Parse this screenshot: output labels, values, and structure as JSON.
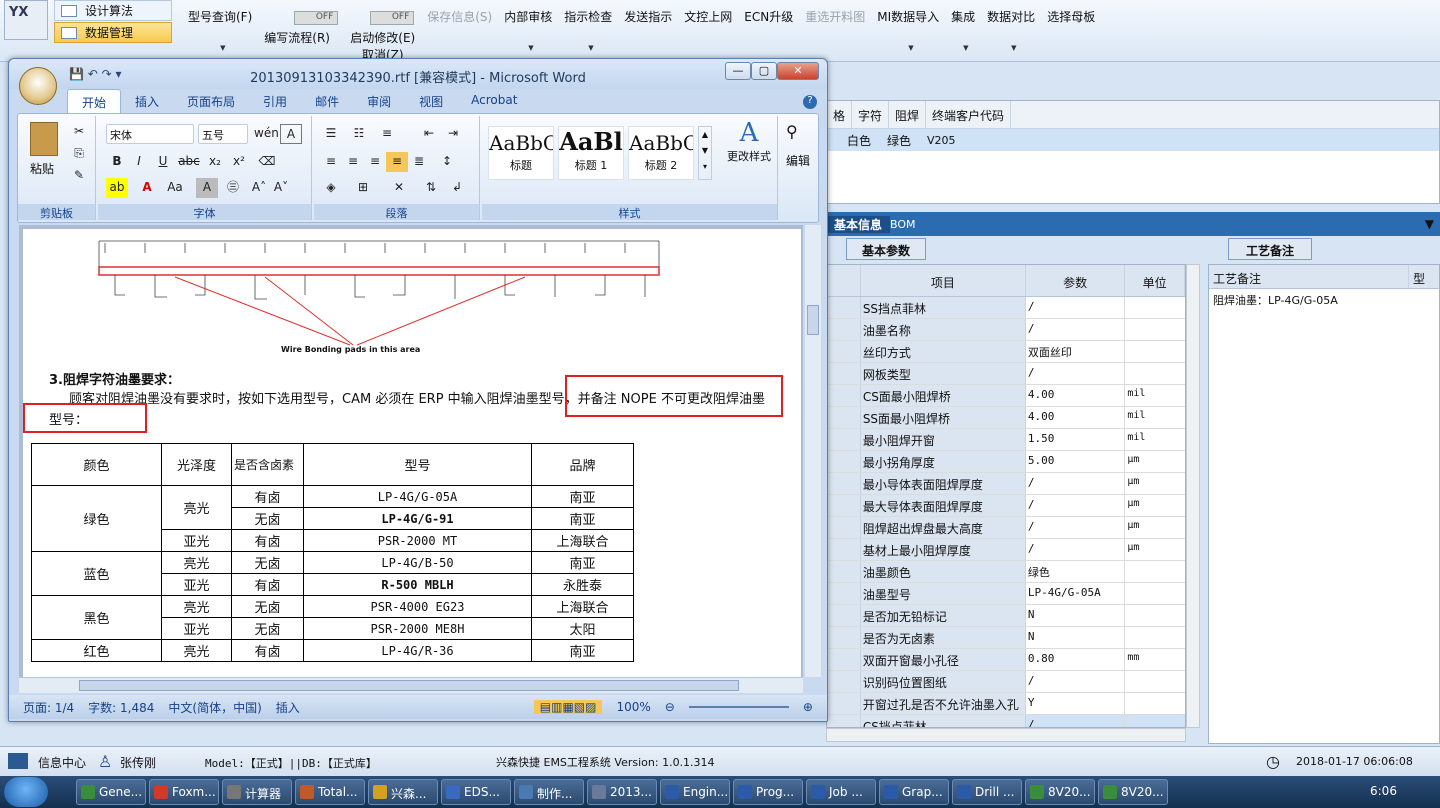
{
  "erp": {
    "logo": "YX",
    "nav": [
      "设计算法",
      "数据管理"
    ],
    "commands": [
      {
        "label": "型号查询(F)",
        "disabled": false
      },
      {
        "label": "编写流程(R)",
        "disabled": false,
        "toggle": "OFF"
      },
      {
        "label": "启动修改(E)",
        "disabled": false,
        "toggle": "OFF",
        "sub": "取消(Z)"
      },
      {
        "label": "保存信息(S)",
        "disabled": true
      },
      {
        "label": "内部审核",
        "disabled": false
      },
      {
        "label": "指示检查",
        "disabled": false
      },
      {
        "label": "发送指示",
        "disabled": false
      },
      {
        "label": "文控上网",
        "disabled": false
      },
      {
        "label": "ECN升级",
        "disabled": false
      },
      {
        "label": "重选开料图",
        "disabled": true
      },
      {
        "label": "MI数据导入",
        "disabled": false
      },
      {
        "label": "集成",
        "disabled": false
      },
      {
        "label": "数据对比",
        "disabled": false
      },
      {
        "label": "选择母板",
        "disabled": false
      }
    ],
    "upper_columns": [
      "格",
      "字符",
      "阻焊",
      "终端客户代码"
    ],
    "upper_row": [
      "白色",
      "绿色",
      "V205"
    ],
    "tabs": [
      "基本信息",
      "BOM"
    ],
    "param_tab": "基本参数",
    "param_headers": [
      "项目",
      "参数",
      "单位"
    ],
    "params": [
      [
        "SS挡点菲林",
        "/",
        ""
      ],
      [
        "油墨名称",
        "/",
        ""
      ],
      [
        "丝印方式",
        "双面丝印",
        ""
      ],
      [
        "网板类型",
        "/",
        ""
      ],
      [
        "CS面最小阻焊桥",
        "4.00",
        "mil"
      ],
      [
        "SS面最小阻焊桥",
        "4.00",
        "mil"
      ],
      [
        "最小阻焊开窗",
        "1.50",
        "mil"
      ],
      [
        "最小拐角厚度",
        "5.00",
        "μm"
      ],
      [
        "最小导体表面阻焊厚度",
        "/",
        "μm"
      ],
      [
        "最大导体表面阻焊厚度",
        "/",
        "μm"
      ],
      [
        "阻焊超出焊盘最大高度",
        "/",
        "μm"
      ],
      [
        "基材上最小阻焊厚度",
        "/",
        "μm"
      ],
      [
        "油墨颜色",
        "绿色",
        ""
      ],
      [
        "油墨型号",
        "LP-4G/G-05A",
        ""
      ],
      [
        "是否加无铅标记",
        "N",
        ""
      ],
      [
        "是否为无卤素",
        "N",
        ""
      ],
      [
        "双面开窗最小孔径",
        "0.80",
        "mm"
      ],
      [
        "识别码位置图纸",
        "/",
        ""
      ],
      [
        "开窗过孔是否不允许油墨入孔",
        "Y",
        ""
      ],
      [
        "CS挡点菲林",
        "/",
        ""
      ]
    ],
    "craft_tab": "工艺备注",
    "craft_headers": [
      "工艺备注",
      "型"
    ],
    "craft_text": "阻焊油墨：LP-4G/G-05A",
    "status": {
      "info": "信息中心",
      "user": "张传刚",
      "model": "Model:【正式】||DB:【正式库】",
      "system": "兴森快捷 EMS工程系统 Version: 1.0.1.314",
      "datetime": "2018-01-17 06:06:08"
    }
  },
  "word": {
    "title": "20130913103342390.rtf [兼容模式] - Microsoft Word",
    "tabs": [
      "开始",
      "插入",
      "页面布局",
      "引用",
      "邮件",
      "审阅",
      "视图",
      "Acrobat"
    ],
    "font": "宋体",
    "size": "五号",
    "groups": [
      "剪贴板",
      "字体",
      "段落",
      "样式",
      "编辑"
    ],
    "paste": "粘贴",
    "styles": [
      {
        "sample": "AaBbC",
        "name": "标题"
      },
      {
        "sample": "AaBl",
        "name": "标题 1"
      },
      {
        "sample": "AaBbC",
        "name": "标题 2"
      }
    ],
    "change_style": "更改样式",
    "edit": "编辑",
    "caption": "Wire Bonding pads in this area",
    "heading": "3.阻焊字符油墨要求：",
    "paragraph": "顾客对阻焊油墨没有要求时，按如下选用型号，CAM 必须在 ERP 中输入阻焊油墨型号，并备注 NOPE 不可更改阻焊油墨型号：",
    "table_headers": [
      "颜色",
      "光泽度",
      "是否含卤素",
      "型号",
      "品牌"
    ],
    "table": [
      {
        "color": "绿色",
        "gloss": "亮光",
        "halogen": "有卤",
        "model": "LP-4G/G-05A",
        "brand": "南亚"
      },
      {
        "color": "",
        "gloss": "",
        "halogen": "无卤",
        "model": "LP-4G/G-91",
        "brand": "南亚"
      },
      {
        "color": "",
        "gloss": "亚光",
        "halogen": "有卤",
        "model": "PSR-2000 MT",
        "brand": "上海联合"
      },
      {
        "color": "蓝色",
        "gloss": "亮光",
        "halogen": "无卤",
        "model": "LP-4G/B-50",
        "brand": "南亚"
      },
      {
        "color": "",
        "gloss": "亚光",
        "halogen": "有卤",
        "model": "R-500 MBLH",
        "brand": "永胜泰"
      },
      {
        "color": "黑色",
        "gloss": "亮光",
        "halogen": "无卤",
        "model": "PSR-4000 EG23",
        "brand": "上海联合"
      },
      {
        "color": "",
        "gloss": "亚光",
        "halogen": "无卤",
        "model": "PSR-2000 ME8H",
        "brand": "太阳"
      },
      {
        "color": "红色",
        "gloss": "亮光",
        "halogen": "有卤",
        "model": "LP-4G/R-36",
        "brand": "南亚"
      }
    ],
    "status": {
      "page": "页面: 1/4",
      "words": "字数: 1,484",
      "lang": "中文(简体，中国)",
      "mode": "插入",
      "zoom": "100%"
    }
  },
  "taskbar": [
    "Gene...",
    "Foxm...",
    "计算器",
    "Total...",
    "兴森...",
    "EDS...",
    "制作...",
    "2013...",
    "Engin...",
    "Prog...",
    "Job ...",
    "Grap...",
    "Drill ...",
    "8V20...",
    "8V20..."
  ],
  "clock": "6:06"
}
